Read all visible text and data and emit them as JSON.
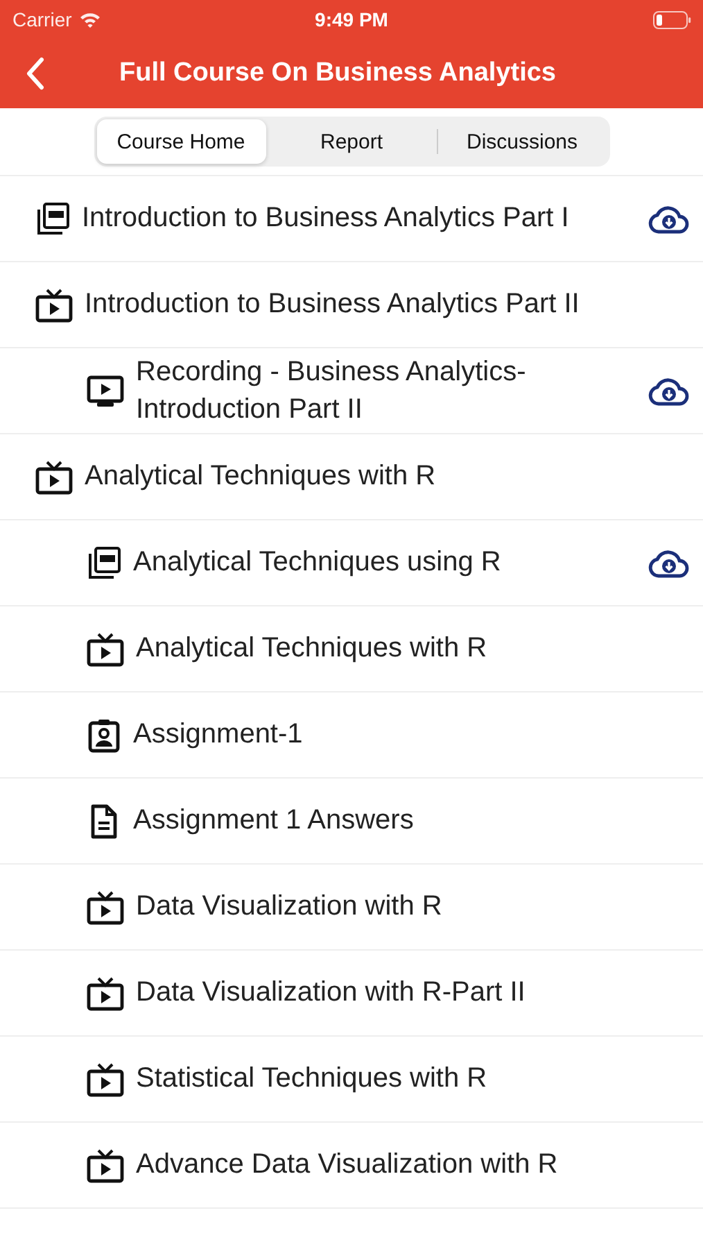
{
  "status_bar": {
    "carrier": "Carrier",
    "time": "9:49 PM"
  },
  "nav": {
    "title": "Full Course On Business Analytics"
  },
  "tabs": [
    {
      "label": "Course Home",
      "selected": true
    },
    {
      "label": "Report",
      "selected": false
    },
    {
      "label": "Discussions",
      "selected": false
    }
  ],
  "items": [
    {
      "kind": "pdf",
      "title": "Introduction to Business Analytics Part I",
      "download": true
    },
    {
      "kind": "video",
      "title": "Introduction to Business Analytics Part II",
      "download": false,
      "children": [
        {
          "kind": "recording",
          "title": "Recording - Business Analytics-Introduction Part II",
          "download": true
        }
      ]
    },
    {
      "kind": "video",
      "title": "Analytical Techniques with R",
      "download": false,
      "children": [
        {
          "kind": "pdf",
          "title": "Analytical Techniques using R",
          "download": true
        },
        {
          "kind": "video",
          "title": "Analytical Techniques with R",
          "download": false
        },
        {
          "kind": "assignment",
          "title": "Assignment-1",
          "download": false
        },
        {
          "kind": "document",
          "title": "Assignment 1 Answers",
          "download": false
        },
        {
          "kind": "video",
          "title": "Data Visualization with R",
          "download": false
        },
        {
          "kind": "video",
          "title": "Data Visualization with R-Part II",
          "download": false
        },
        {
          "kind": "video",
          "title": "Statistical Techniques with R",
          "download": false
        },
        {
          "kind": "video",
          "title": "Advance Data Visualization with R",
          "download": false
        }
      ]
    }
  ]
}
